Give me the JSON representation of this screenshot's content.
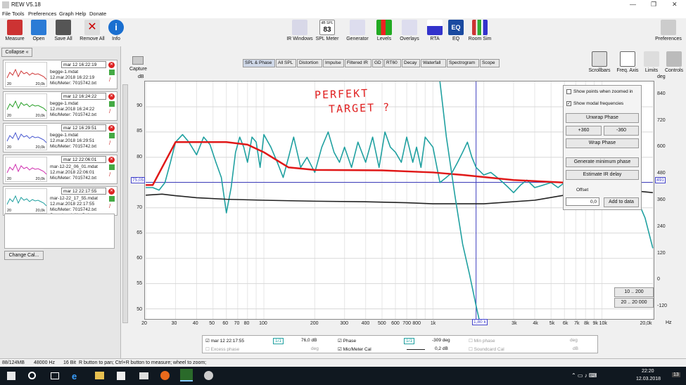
{
  "window": {
    "title": "REW V5.18",
    "controls": [
      "—",
      "❐",
      "✕"
    ]
  },
  "menu": [
    "File",
    "Tools",
    "Preferences",
    "Graph",
    "Help",
    "Donate"
  ],
  "toolbar": {
    "left": [
      "Measure",
      "Open",
      "Save All",
      "Remove All",
      "Info"
    ],
    "center": [
      "IR Windows",
      "SPL Meter",
      "Generator",
      "Levels",
      "Overlays",
      "RTA",
      "EQ",
      "Room Sim"
    ],
    "spl_meter_top": "dB SPL",
    "spl_meter_value": "83",
    "right": "Preferences"
  },
  "sidebar": {
    "collapse": "Collapse",
    "change_cal": "Change Cal...",
    "measurements": [
      {
        "time": "mar 12 16:22:19",
        "name": "begge-1.mdat",
        "date": "12.mar.2018 16:22:19",
        "mic": "Mic/Meter: 7015742.txt",
        "color": "#d03a3a"
      },
      {
        "time": "mar 12 16:24:22",
        "name": "begge-1.mdat",
        "date": "12.mar.2018 16:24:22",
        "mic": "Mic/Meter: 7015742.txt",
        "color": "#2aa02a"
      },
      {
        "time": "mar 12 16:29:51",
        "name": "begge-1.mdat",
        "date": "12.mar.2018 16:29:51",
        "mic": "Mic/Meter: 7015742.txt",
        "color": "#4a5ad0"
      },
      {
        "time": "mar 12 22:06:01",
        "name": "mar-12-22_06_01.mdat",
        "date": "12.mar.2018 22:06:01",
        "mic": "Mic/Meter: 7015742.txt",
        "color": "#d030b0"
      },
      {
        "time": "mar 12 22:17:55",
        "name": "mar-12-22_17_55.mdat",
        "date": "12.mar.2018 22:17:55",
        "mic": "Mic/Meter: 7015742.txt",
        "color": "#20a0a0",
        "extra": "Soundcard: No Cal"
      }
    ],
    "thumb_x": [
      "20",
      "20,0k"
    ]
  },
  "graph": {
    "capture": "Capture",
    "tabs": [
      "SPL & Phase",
      "All SPL",
      "Distortion",
      "Impulse",
      "Filtered IR",
      "GD",
      "RT60",
      "Decay",
      "Waterfall",
      "Spectrogram",
      "Scope"
    ],
    "active_tab": "SPL & Phase",
    "right_tools": [
      "Scrollbars",
      "Freq. Axis",
      "Limits",
      "Controls"
    ],
    "y_unit": "dB",
    "y2_unit": "deg",
    "x_unit": "Hz",
    "cursor_y_left": "75,05",
    "cursor_y_right": "491",
    "cursor_x": "1,80 k",
    "annotation_line1": "PERFEKT",
    "annotation_line2": "TARGET ?"
  },
  "controls": {
    "show_points": "Show points when zoomed in",
    "show_modal": "Show modal frequencies",
    "unwrap": "Unwrap Phase",
    "plus360": "+360",
    "minus360": "-360",
    "wrap": "Wrap Phase",
    "gen_min": "Generate minimum phase",
    "estimate": "Estimate IR delay",
    "offset_label": "Offset",
    "offset_value": "0,0",
    "add_to_data": "Add to data",
    "range1": "10 .. 200",
    "range2": "20 .. 20 000"
  },
  "legend": {
    "meas": "mar 12 22:17:55",
    "meas_val": "76,0 dB",
    "phase": "Phase",
    "phase_val": "-309 deg",
    "min_phase": "Min phase",
    "min_phase_unit": "deg",
    "excess": "Excess phase",
    "excess_unit": "deg",
    "mic_cal": "Mic/Meter Cal",
    "mic_val": "0,2 dB",
    "sc_cal": "Soundcard Cal",
    "sc_unit": "dB",
    "scale_label": "1/1"
  },
  "status": {
    "mem": "88/124MB",
    "rate": "48000 Hz",
    "bits": "16 Bit",
    "hint": "R button to pan; Ctrl+R button to measure; wheel to zoom;"
  },
  "taskbar": {
    "time": "22:20",
    "date": "12.03.2018",
    "badge": "13"
  },
  "chart_data": {
    "type": "line",
    "xscale": "log",
    "xlim": [
      20,
      20000
    ],
    "ylim": [
      48,
      95
    ],
    "y2lim": [
      -180,
      900
    ],
    "x_ticks": [
      "20",
      "30",
      "40",
      "50",
      "60",
      "70",
      "80",
      "100",
      "200",
      "300",
      "400",
      "500",
      "600",
      "700",
      "800",
      "1k",
      "2k",
      "3k",
      "4k",
      "5k",
      "6k",
      "7k",
      "8k",
      "9k",
      "10k",
      "20,0k"
    ],
    "x_tick_values": [
      20,
      30,
      40,
      50,
      60,
      70,
      80,
      100,
      200,
      300,
      400,
      500,
      600,
      700,
      800,
      1000,
      2000,
      3000,
      4000,
      5000,
      6000,
      7000,
      8000,
      9000,
      10000,
      20000
    ],
    "y_ticks": [
      50,
      55,
      60,
      65,
      70,
      75,
      80,
      85,
      90
    ],
    "y2_ticks": [
      -120,
      0,
      120,
      240,
      360,
      480,
      600,
      720,
      840
    ],
    "series": [
      {
        "color": "#1fa0a0",
        "x": [
          20,
          22,
          24,
          26,
          28,
          30,
          33,
          36,
          40,
          44,
          48,
          52,
          56,
          60,
          64,
          68,
          72,
          76,
          80,
          85,
          90,
          95,
          100,
          110,
          120,
          130,
          140,
          150,
          165,
          180,
          200,
          220,
          240,
          260,
          280,
          300,
          330,
          360,
          400,
          440,
          480,
          520,
          560,
          600,
          650,
          700,
          760,
          800,
          850,
          900,
          1000,
          1100,
          1200,
          1300,
          1400,
          1500,
          1600,
          1700,
          1800,
          2000,
          2200,
          2400,
          2600,
          2800,
          3000,
          3300,
          3600,
          4000,
          4500,
          5000,
          5500,
          6000,
          7000,
          8000,
          9000,
          10000,
          11000,
          12000,
          13000,
          14000,
          15000,
          16000,
          18000,
          20000
        ],
        "y": [
          74,
          74,
          73.5,
          75,
          79,
          83,
          84.5,
          83,
          80.5,
          84,
          82.5,
          79,
          76,
          69,
          74,
          81,
          84,
          82,
          79,
          84,
          83,
          78,
          84.5,
          82,
          79,
          76,
          80,
          84,
          78,
          80,
          77,
          82,
          85,
          81,
          79,
          82,
          78,
          83,
          79,
          84,
          78,
          85,
          82,
          81,
          79,
          84,
          79,
          82,
          78,
          84,
          82,
          75,
          76,
          77,
          79,
          81,
          83,
          80,
          78,
          76.5,
          77,
          76,
          75,
          74,
          73,
          74.5,
          75.5,
          74,
          74.5,
          75,
          74,
          75,
          74,
          76,
          74.5,
          75,
          76.5,
          76,
          74.5,
          75.5,
          75,
          72,
          68,
          62
        ]
      },
      {
        "color": "#e01818",
        "x": [
          20,
          22,
          30,
          60,
          80,
          100,
          140,
          200,
          500,
          1000,
          1500,
          3000,
          6000,
          10000,
          13000,
          16000
        ],
        "y": [
          74.5,
          74.5,
          83,
          83,
          82.5,
          81,
          78,
          77.5,
          77.4,
          77,
          76.5,
          75.5,
          75,
          74.5,
          74,
          73.5
        ]
      },
      {
        "color": "#222222",
        "x": [
          20,
          25,
          30,
          40,
          60,
          100,
          200,
          400,
          700,
          1000,
          2000,
          4000,
          6000,
          10000,
          14000,
          20000
        ],
        "y": [
          72.5,
          72.7,
          72.4,
          72,
          71.7,
          71.5,
          71.3,
          71.2,
          71,
          70.8,
          70.8,
          71.5,
          72.5,
          73.5,
          73.5,
          73
        ]
      },
      {
        "color": "#1fa0a0",
        "axis": "y2",
        "x": [
          1100,
          1200,
          1350,
          1500,
          1650,
          1800,
          1900
        ],
        "y": [
          900,
          650,
          380,
          160,
          20,
          -120,
          -200
        ]
      }
    ]
  }
}
